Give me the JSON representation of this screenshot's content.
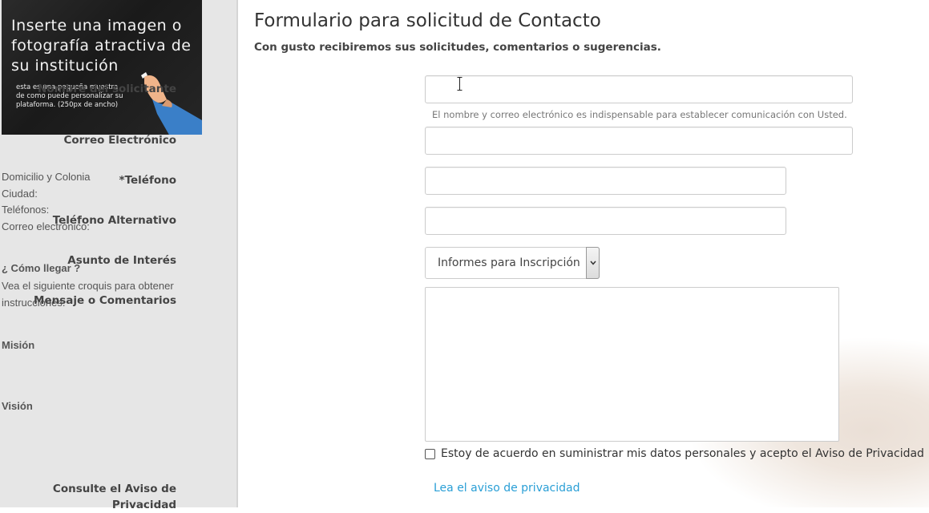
{
  "sidebar": {
    "banner": {
      "title": "Inserte una imagen o fotografía atractiva de su institución",
      "note": "esta es una pequeña muestra de como puede personalizar su plataforma. (250px de ancho)"
    },
    "info": {
      "address_label": "Domicilio y Colonia",
      "city_label": "Ciudad:",
      "phones_label": "Teléfonos:",
      "email_label": "Correo electrónico:"
    },
    "directions": {
      "heading": "¿ Cómo llegar ?",
      "text": "Vea el siguiente croquis para obtener instrucciones."
    },
    "mission_heading": "Misión",
    "vision_heading": "Visión"
  },
  "form": {
    "title": "Formulario para solicitud de Contacto",
    "subtitle": "Con gusto recibiremos sus solicitudes, comentarios o sugerencias.",
    "name_label": "Nombre del solicitante",
    "name_help": "El nombre y correo electrónico es indispensable para establecer comunicación con Usted.",
    "email_label": "Correo Electrónico",
    "phone_label": "*Teléfono",
    "alt_phone_label": "Teléfono Alternativo",
    "subject_label": "Asunto de Interés",
    "subject_value": "Informes para Inscripción",
    "message_label": "Mensaje o Comentarios",
    "consent_label": "Estoy de acuerdo en suministrar mis datos personales y acepto el Aviso de Privacidad",
    "privacy_label": "Consulte el Aviso de Privacidad",
    "privacy_link": "Lea el aviso de privacidad"
  },
  "colors": {
    "sidebar_bg": "#e6e6e6",
    "link": "#2a9fd6",
    "text": "#444444"
  }
}
